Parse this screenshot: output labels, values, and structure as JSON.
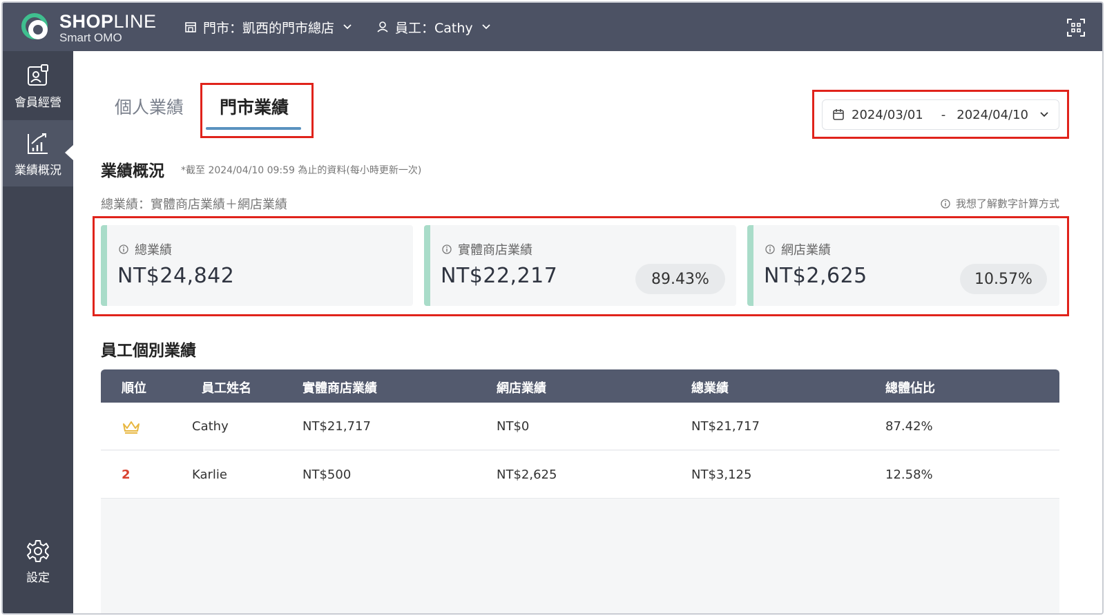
{
  "brand": {
    "name": "SHOPLINE",
    "name_lead": "SHO",
    "name_p": "P",
    "name_tail": "LINE",
    "sub": "Smart OMO"
  },
  "header": {
    "store_label": "門市：凱西的門市總店",
    "staff_label": "員工：Cathy"
  },
  "sidebar": {
    "items": [
      {
        "label": "會員經營"
      },
      {
        "label": "業績概況"
      },
      {
        "label": "設定"
      }
    ]
  },
  "tabs": [
    {
      "label": "個人業績"
    },
    {
      "label": "門市業績"
    }
  ],
  "date_range": {
    "start": "2024/03/01",
    "separator": "-",
    "end": "2024/04/10"
  },
  "overview": {
    "title": "業績概況",
    "note": "*截至 2024/04/10 09:59 為止的資料(每小時更新一次)",
    "formula": "總業績：實體商店業績＋網店業績",
    "learn_link": "我想了解數字計算方式"
  },
  "cards": {
    "total": {
      "caption": "總業績",
      "amount": "NT$24,842"
    },
    "store": {
      "caption": "實體商店業績",
      "amount": "NT$22,217",
      "percent": "89.43%"
    },
    "online": {
      "caption": "網店業績",
      "amount": "NT$2,625",
      "percent": "10.57%"
    }
  },
  "staff_table": {
    "title": "員工個別業績",
    "columns": [
      "順位",
      "員工姓名",
      "實體商店業績",
      "網店業績",
      "總業績",
      "總體佔比"
    ],
    "rows": [
      {
        "rank": "1",
        "rank_icon": "crown-icon",
        "name": "Cathy",
        "store": "NT$21,717",
        "online": "NT$0",
        "total": "NT$21,717",
        "share": "87.42%"
      },
      {
        "rank": "2",
        "name": "Karlie",
        "store": "NT$500",
        "online": "NT$2,625",
        "total": "NT$3,125",
        "share": "12.58%"
      }
    ]
  },
  "colors": {
    "header_bg": "#4c5264",
    "sidebar_bg": "#3f4452",
    "table_header_bg": "#535a6e",
    "card_accent": "#a9dcc9",
    "tab_underline": "#5a92bf",
    "highlight_box": "#e0231b",
    "rank_number": "#d9412e",
    "crown": "#e8b740"
  }
}
